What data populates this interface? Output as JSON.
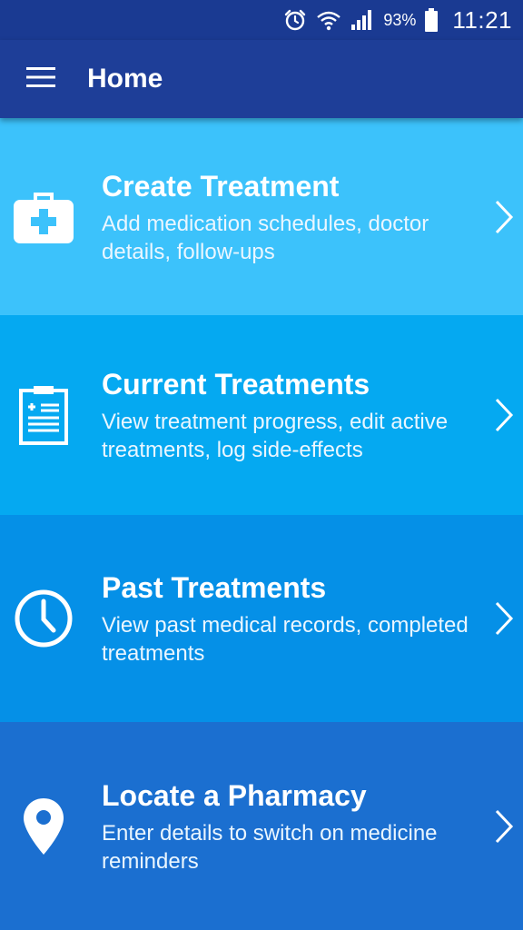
{
  "status_bar": {
    "battery_percent": "93%",
    "time": "11:21",
    "icons": [
      "alarm-icon",
      "wifi-icon",
      "signal-icon",
      "battery-icon"
    ]
  },
  "app_bar": {
    "title": "Home",
    "menu_icon": "hamburger-menu-icon"
  },
  "cards": [
    {
      "title": "Create Treatment",
      "description": "Add medication schedules, doctor details, follow-ups",
      "icon": "first-aid-kit-icon",
      "color": "#3cc2fb"
    },
    {
      "title": "Current Treatments",
      "description": "View treatment progress, edit active treatments, log side-effects",
      "icon": "clipboard-icon",
      "color": "#05a9f1"
    },
    {
      "title": "Past Treatments",
      "description": "View past medical records, completed treatments",
      "icon": "clock-icon",
      "color": "#0590e7"
    },
    {
      "title": "Locate a Pharmacy",
      "description": "Enter details to switch on medicine reminders",
      "icon": "location-pin-icon",
      "color": "#1b6fd0"
    }
  ]
}
